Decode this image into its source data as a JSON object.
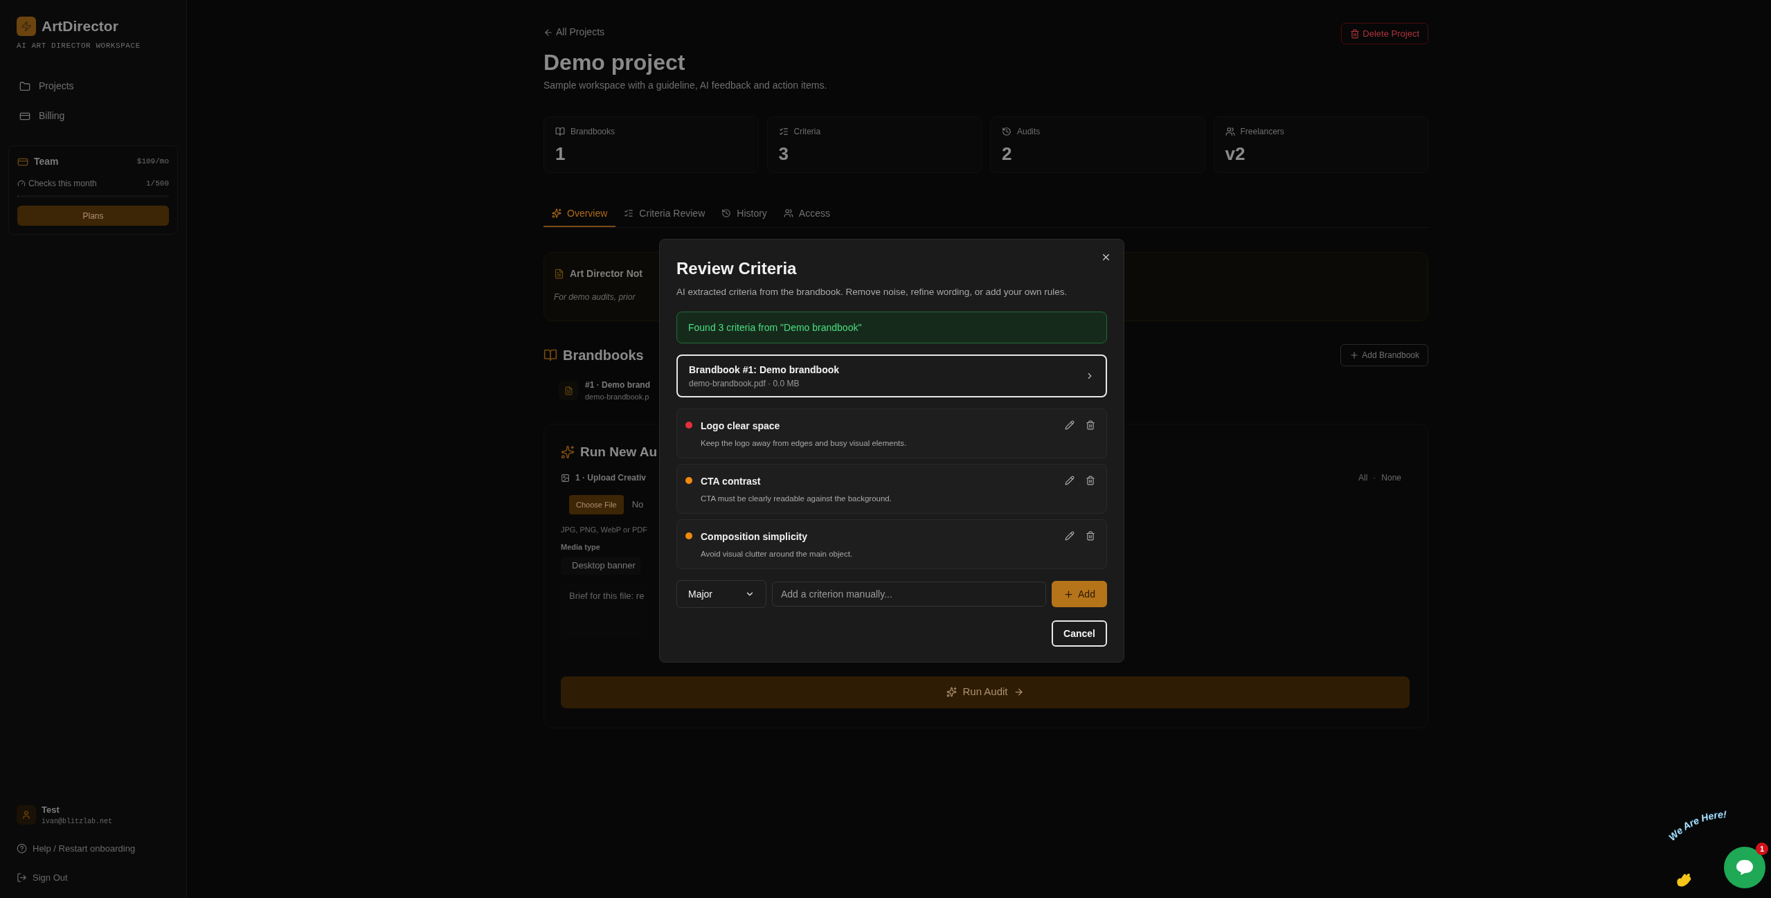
{
  "sidebar": {
    "brand": "ArtDirector",
    "tagline": "AI ART DIRECTOR WORKSPACE",
    "nav": [
      {
        "label": "Projects"
      },
      {
        "label": "Billing"
      }
    ],
    "plan": {
      "name": "Team",
      "price": "$109/mo",
      "usage_label": "Checks this month",
      "usage": "1/500",
      "level": 0.002,
      "button": "Plans"
    },
    "user": {
      "name": "Test",
      "email": "ivan@blitzlab.net"
    },
    "footer": [
      "Help / Restart onboarding",
      "Sign Out"
    ]
  },
  "page": {
    "back": "All Projects",
    "delete": "Delete Project",
    "title": "Demo project",
    "subtitle": "Sample workspace with a guideline, AI feedback and action items.",
    "stats": [
      {
        "label": "Brandbooks",
        "value": "1"
      },
      {
        "label": "Criteria",
        "value": "3"
      },
      {
        "label": "Audits",
        "value": "2"
      },
      {
        "label": "Freelancers",
        "value": "v2"
      }
    ],
    "tabs": [
      {
        "label": "Overview",
        "selected": true
      },
      {
        "label": "Criteria Review",
        "selected": false
      },
      {
        "label": "History",
        "selected": false
      },
      {
        "label": "Access",
        "selected": false
      }
    ],
    "notes": {
      "title": "Art Director Not",
      "text": "For demo audits, prior"
    },
    "brandbooks": {
      "title": "Brandbooks",
      "add": "Add Brandbook",
      "items": [
        {
          "name": "#1 · Demo brand",
          "file": "demo-brandbook.p"
        }
      ]
    },
    "audit": {
      "title": "Run New Au",
      "step": "1 · Upload Creativ",
      "choose": "Choose File",
      "no_file": "No",
      "formats": "JPG, PNG, WebP or PDF",
      "media_label": "Media type",
      "media_value": "Desktop banner",
      "brief_placeholder": "Brief for this file: re",
      "select_all": "All",
      "separator": "·",
      "select_none": "None",
      "run": "Run Audit"
    }
  },
  "dialog": {
    "title": "Review Criteria",
    "description": "AI extracted criteria from the brandbook. Remove noise, refine wording, or add your own rules.",
    "notice": "Found 3 criteria from \"Demo brandbook\"",
    "brandbook": {
      "title": "Brandbook #1: Demo brandbook",
      "meta": "demo-brandbook.pdf · 0.0 MB"
    },
    "criteria": [
      {
        "title": "Logo clear space",
        "description": "Keep the logo away from edges and busy visual elements.",
        "color": "#e5303a"
      },
      {
        "title": "CTA contrast",
        "description": "CTA must be clearly readable against the background.",
        "color": "#f08a0c"
      },
      {
        "title": "Composition simplicity",
        "description": "Avoid visual clutter around the main object.",
        "color": "#f08a0c"
      }
    ],
    "severity": "Major",
    "input_placeholder": "Add a criterion manually...",
    "add": "Add",
    "cancel": "Cancel"
  },
  "chat_widget": {
    "text": "We Are Here!",
    "badge": "1"
  }
}
